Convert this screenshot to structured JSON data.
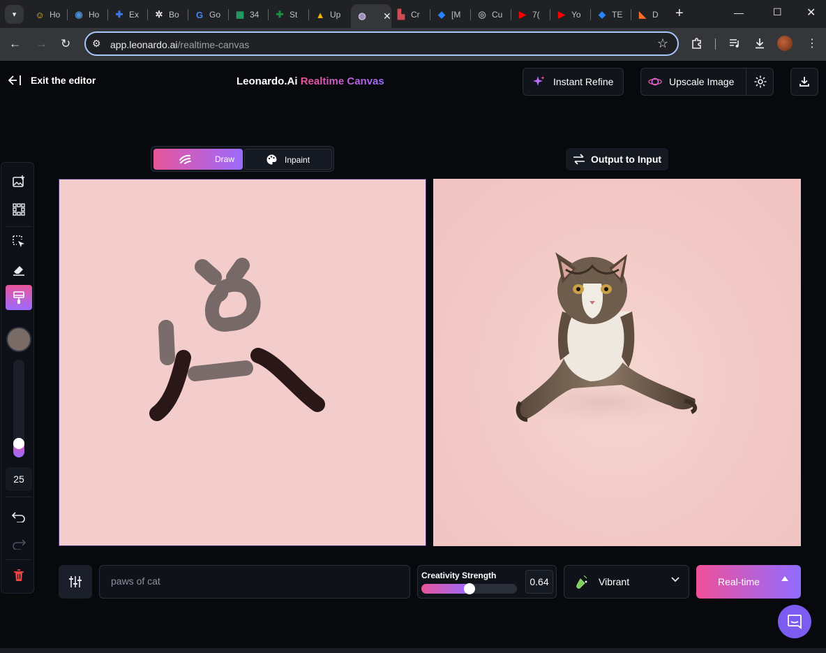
{
  "browser": {
    "tabs": [
      {
        "label": "Ho",
        "icon": "smiley-icon",
        "color": "#f9c52b"
      },
      {
        "label": "Ho",
        "icon": "hub-icon",
        "color": "#4e8cd4"
      },
      {
        "label": "Ex",
        "icon": "puzzle-icon",
        "color": "#3b78e7"
      },
      {
        "label": "Bo",
        "icon": "openai-icon",
        "color": "#e8eaed"
      },
      {
        "label": "Go",
        "icon": "translate-icon",
        "color": "#4285f4"
      },
      {
        "label": "34",
        "icon": "sheets-icon",
        "color": "#23a566"
      },
      {
        "label": "St",
        "icon": "plus-circle-icon",
        "color": "#1e8e3e"
      },
      {
        "label": "Up",
        "icon": "grad-cap-icon",
        "color": "#f4b400"
      },
      {
        "label": "",
        "icon": "leonardo-icon",
        "color": "#c9b9e8",
        "active": true
      },
      {
        "label": "Cr",
        "icon": "building-icon",
        "color": "#d04b56"
      },
      {
        "label": "[M",
        "icon": "jira-icon",
        "color": "#2684ff"
      },
      {
        "label": "Cu",
        "icon": "globe-icon",
        "color": "#9aa0a6"
      },
      {
        "label": "7(",
        "icon": "youtube-icon",
        "color": "#ff0000"
      },
      {
        "label": "Yo",
        "icon": "youtube-icon",
        "color": "#ff0000"
      },
      {
        "label": "TE",
        "icon": "jira-icon",
        "color": "#2684ff"
      },
      {
        "label": "D",
        "icon": "gitlab-icon",
        "color": "#fc6d26"
      }
    ],
    "url_host": "app.leonardo.ai",
    "url_path": "/realtime-canvas"
  },
  "header": {
    "exit_label": "Exit the editor",
    "brand_main": "Leonardo.Ai",
    "brand_accent": "Realtime Canvas",
    "instant_refine_label": "Instant Refine",
    "upscale_label": "Upscale Image"
  },
  "modes": {
    "draw_label": "Draw",
    "inpaint_label": "Inpaint"
  },
  "output_to_input_label": "Output to Input",
  "toolbar": {
    "brush_color": "#796b66",
    "brush_size_fraction": 0.1,
    "brush_size": "25"
  },
  "bottom_bar": {
    "prompt_value": "paws of cat",
    "creativity_label": "Creativity Strength",
    "creativity_value": "0.64",
    "creativity_fraction": 0.5,
    "style_label": "Vibrant",
    "generate_label": "Real-time"
  },
  "colors": {
    "accent_pink": "#e8559a",
    "accent_purple": "#9c6bff",
    "canvas_bg": "#f3cdcc"
  }
}
